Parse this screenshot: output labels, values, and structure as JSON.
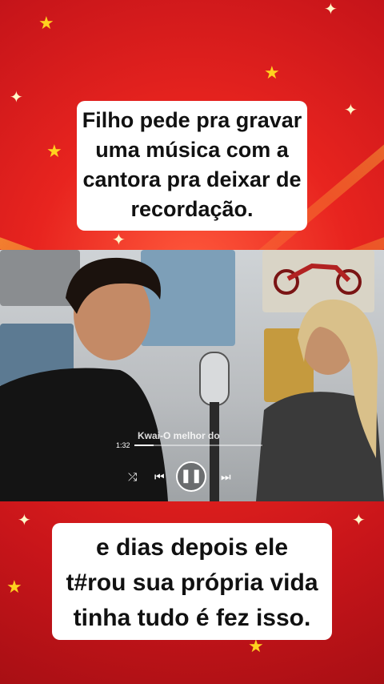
{
  "caption_top": {
    "line1": "Filho pede pra gravar",
    "line2": "uma música com a",
    "line3": "cantora pra deixar de",
    "line4": "recordação."
  },
  "caption_bottom": {
    "line1": "e dias depois ele",
    "line2": "t#rou sua própria vida",
    "line3": "tinha tudo é fez isso."
  },
  "video": {
    "watermark": "Kwai-O melhor do ",
    "time": "1:32",
    "progress": 0.15
  },
  "colors": {
    "background": "#d81e1e",
    "caption_bg": "#ffffff",
    "text": "#111111"
  }
}
